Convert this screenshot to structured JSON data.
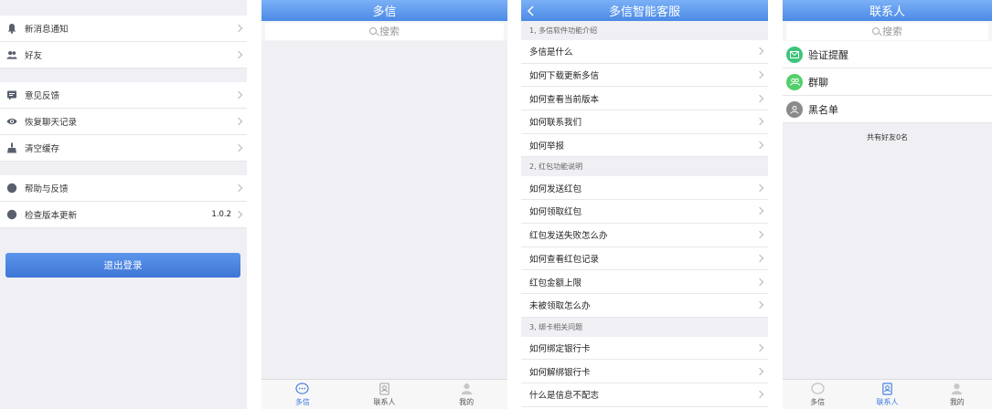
{
  "colors": {
    "header_blue": "#4c8ae6",
    "tab_active": "#3a79e0",
    "page_bg": "#efeff4",
    "verify_green": "#3ec47a",
    "group_green": "#53cf6a",
    "blacklist_gray": "#8a8a8a"
  },
  "settings": {
    "groups": [
      [
        {
          "label": "新消息通知",
          "icon": "bell-icon"
        },
        {
          "label": "好友",
          "icon": "friends-icon"
        }
      ],
      [
        {
          "label": "意见反馈",
          "icon": "feedback-icon"
        },
        {
          "label": "恢复聊天记录",
          "icon": "eye-icon"
        },
        {
          "label": "清空缓存",
          "icon": "broom-icon"
        }
      ],
      [
        {
          "label": "帮助与反馈",
          "icon": "help-icon"
        },
        {
          "label": "检查版本更新",
          "icon": "update-icon",
          "value": "1.0.2"
        }
      ]
    ],
    "logout_label": "退出登录"
  },
  "chats": {
    "title": "多信",
    "search_placeholder": "搜索",
    "tabs": [
      {
        "label": "多信",
        "icon": "chat-bubble-icon",
        "active": true
      },
      {
        "label": "联系人",
        "icon": "contacts-icon",
        "active": false
      },
      {
        "label": "我的",
        "icon": "person-icon",
        "active": false
      }
    ]
  },
  "service": {
    "title": "多信智能客服",
    "sections": [
      {
        "header": "1, 多信软件功能介绍",
        "items": [
          "多信是什么",
          "如何下载更新多信",
          "如何查看当前版本",
          "如何联系我们",
          "如何举报"
        ]
      },
      {
        "header": "2, 红包功能说明",
        "items": [
          "如何发送红包",
          "如何领取红包",
          "红包发送失败怎么办",
          "如何查看红包记录",
          "红包金额上限",
          "未被领取怎么办"
        ]
      },
      {
        "header": "3, 绑卡相关问题",
        "items": [
          "如何绑定银行卡",
          "如何解绑银行卡",
          "什么是信息不配志"
        ]
      }
    ]
  },
  "contacts": {
    "title": "联系人",
    "search_placeholder": "搜索",
    "items": [
      {
        "label": "验证提醒",
        "icon": "envelope-icon"
      },
      {
        "label": "群聊",
        "icon": "group-icon"
      },
      {
        "label": "黑名单",
        "icon": "blacklist-icon"
      }
    ],
    "count_text": "共有好友0名",
    "tabs": [
      {
        "label": "多信",
        "icon": "chat-bubble-icon",
        "active": false
      },
      {
        "label": "联系人",
        "icon": "contacts-icon",
        "active": true
      },
      {
        "label": "我的",
        "icon": "person-icon",
        "active": false
      }
    ]
  }
}
